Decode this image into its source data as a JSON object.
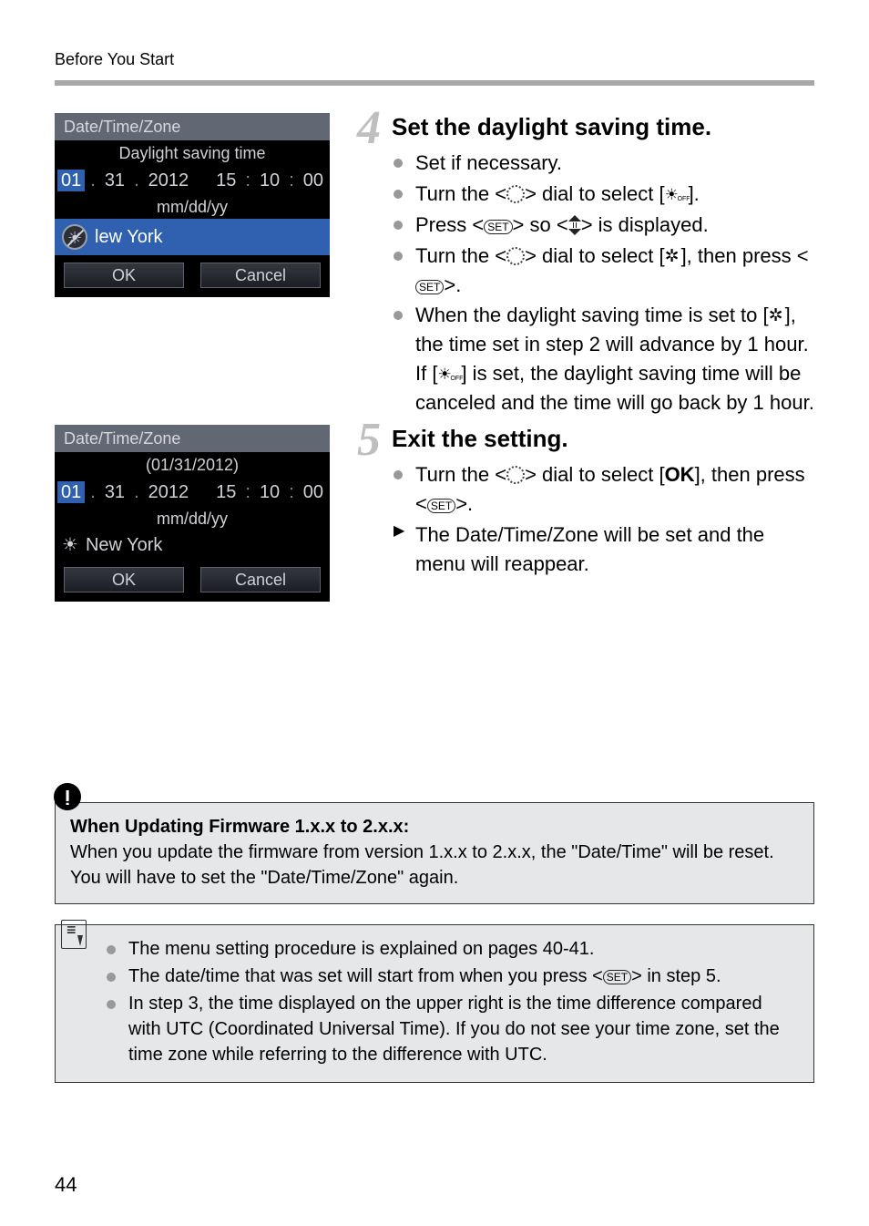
{
  "header": "Before You Start",
  "page_number": "44",
  "screen1": {
    "title": "Date/Time/Zone",
    "subtitle": "Daylight saving time",
    "date_parts": [
      "01",
      "31",
      "2012",
      "15",
      "10",
      "00"
    ],
    "format": "mm/dd/yy",
    "zone": "lew York",
    "ok": "OK",
    "cancel": "Cancel",
    "dst_icon": "sun-off-icon"
  },
  "screen2": {
    "title": "Date/Time/Zone",
    "subtitle": "(01/31/2012)",
    "date_parts": [
      "01",
      "31",
      "2012",
      "15",
      "10",
      "00"
    ],
    "format": "mm/dd/yy",
    "zone": "New York",
    "ok": "OK",
    "cancel": "Cancel",
    "dst_icon": "sun-icon"
  },
  "step4": {
    "num": "4",
    "title": "Set the daylight saving time.",
    "b1": "Set if necessary.",
    "b2a": "Turn the <",
    "b2b": "> dial to select [",
    "b2c": "].",
    "b3a": "Press <",
    "b3b": "> so <",
    "b3c": "> is displayed.",
    "b4a": "Turn the <",
    "b4b": "> dial to select [",
    "b4c": "], then press <",
    "b4d": ">.",
    "b5a": "When the daylight saving time is set to [",
    "b5b": "], the time set in step 2 will advance by 1 hour. If [",
    "b5c": "] is set, the daylight saving time will be canceled and the time will go back by 1 hour."
  },
  "step5": {
    "num": "5",
    "title": "Exit the setting.",
    "b1a": "Turn the <",
    "b1b": "> dial to select [",
    "b1c": "OK",
    "b1d": "], then press <",
    "b1e": ">.",
    "b2": "The Date/Time/Zone will be set and the menu will reappear."
  },
  "note": {
    "title": "When Updating Firmware 1.x.x to 2.x.x:",
    "body": "When you update the firmware from version 1.x.x to 2.x.x, the \"Date/Time\" will be reset. You will have to set the \"Date/Time/Zone\" again."
  },
  "tips": {
    "t1": "The menu setting procedure is explained on pages 40-41.",
    "t2a": "The date/time that was set will start from when you press <",
    "t2b": "> in step 5.",
    "t3": "In step 3, the time displayed on the upper right is the time difference compared with UTC (Coordinated Universal Time). If you do not see your time zone, set the time zone while referring to the difference with UTC."
  }
}
